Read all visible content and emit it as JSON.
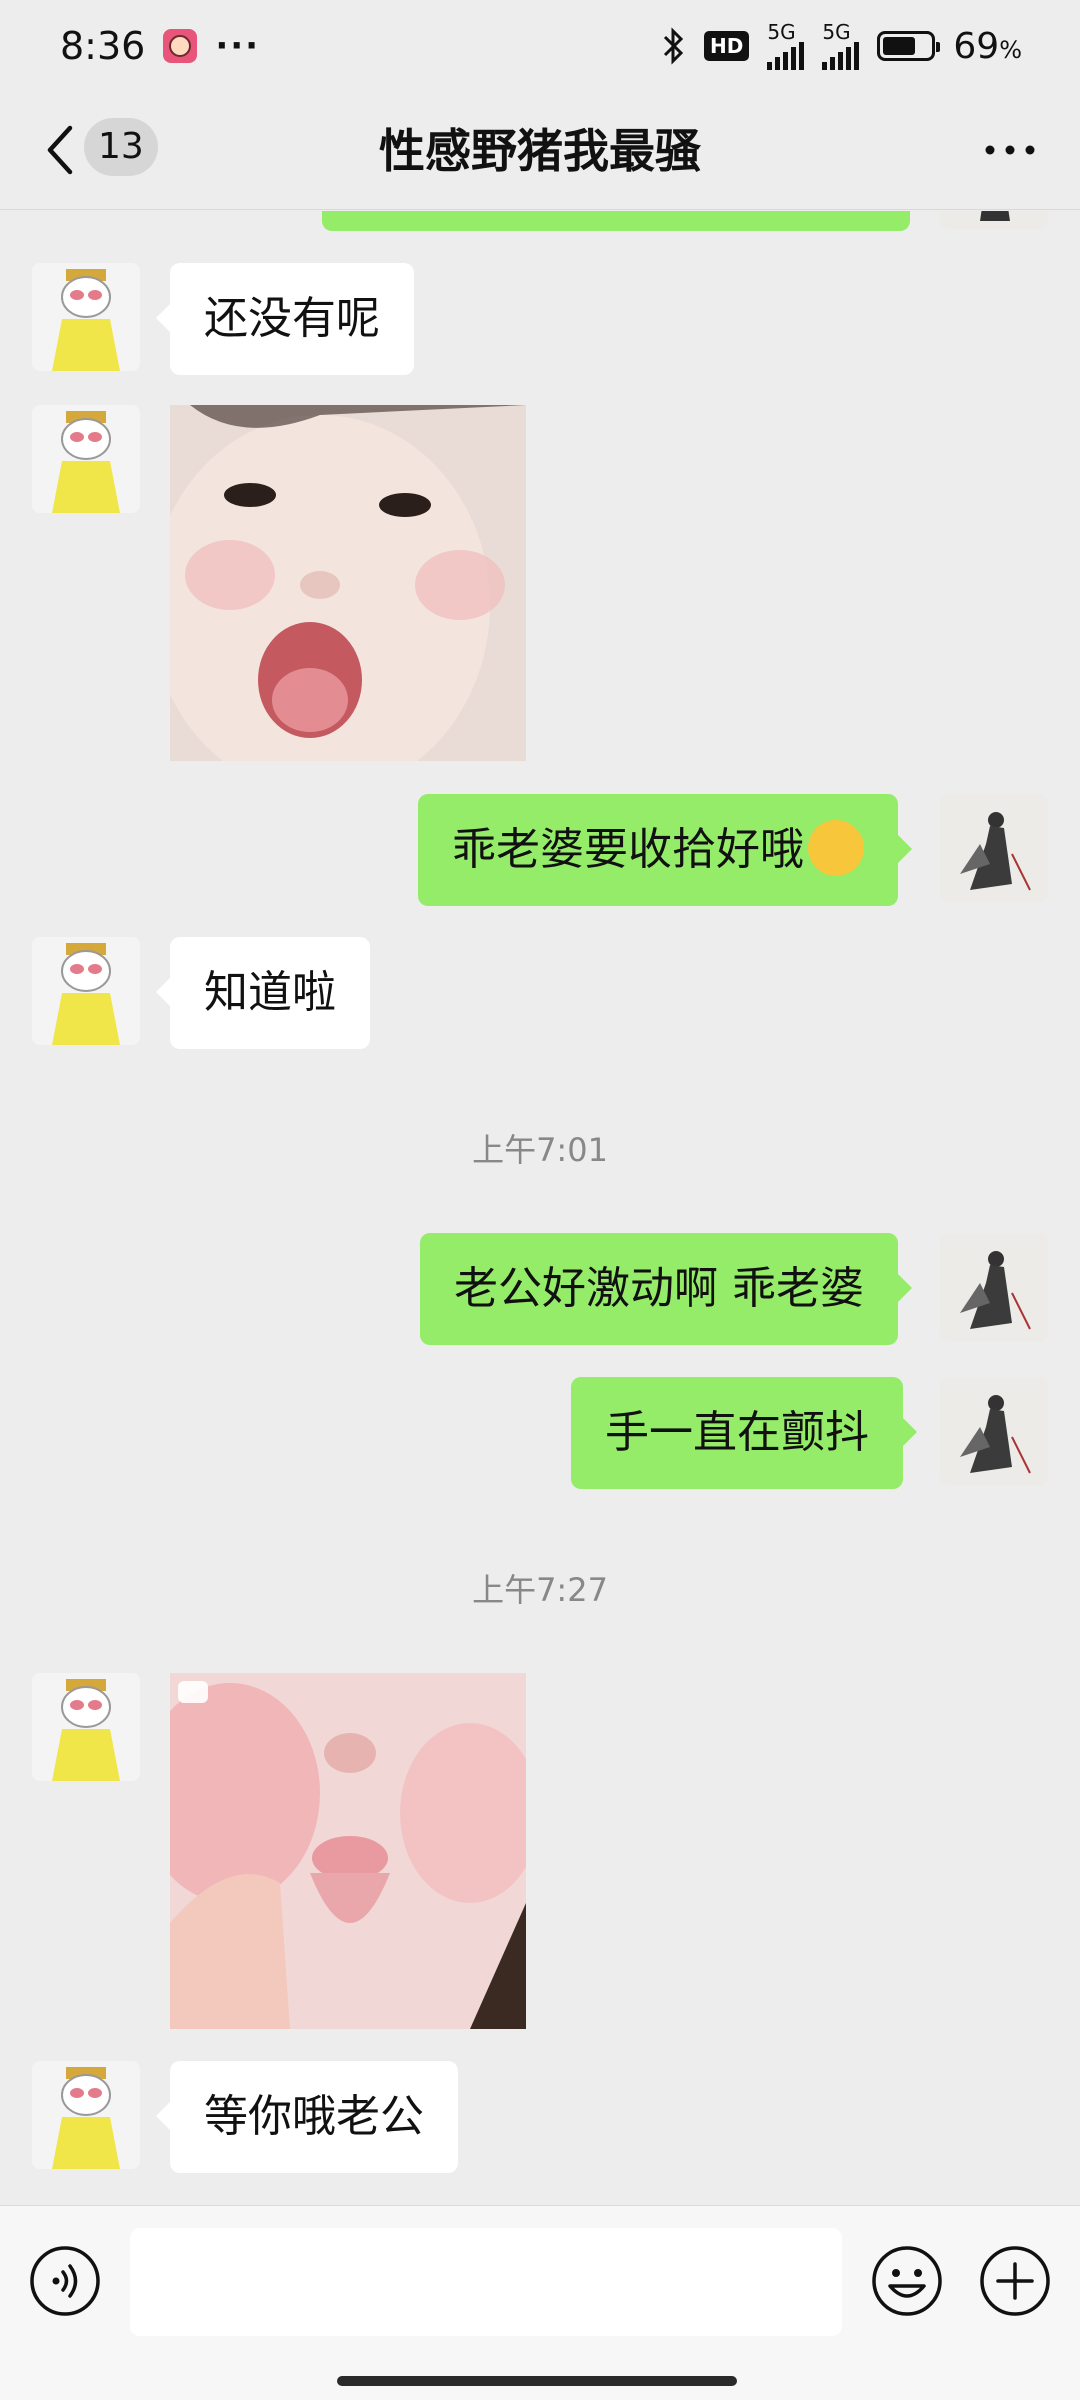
{
  "status_bar": {
    "time": "8:36",
    "more": "···",
    "hd": "HD",
    "network_1": "5G",
    "network_2": "5G",
    "battery_percent": "69",
    "battery_unit": "%",
    "battery_level": 0.69
  },
  "nav": {
    "unread_count": "13",
    "title": "性感野猪我最骚"
  },
  "messages": {
    "m1": "还没有呢",
    "m2": "乖老婆要收拾好哦",
    "m3": "知道啦",
    "ts1": "上午7:01",
    "m4": "老公好激动啊 乖老婆",
    "m5": "手一直在颤抖",
    "ts2": "上午7:27",
    "m6": "等你哦老公"
  },
  "input": {
    "value": "",
    "placeholder": ""
  },
  "colors": {
    "self_bubble": "#95ec69",
    "friend_bubble": "#ffffff",
    "background": "#ededed"
  }
}
